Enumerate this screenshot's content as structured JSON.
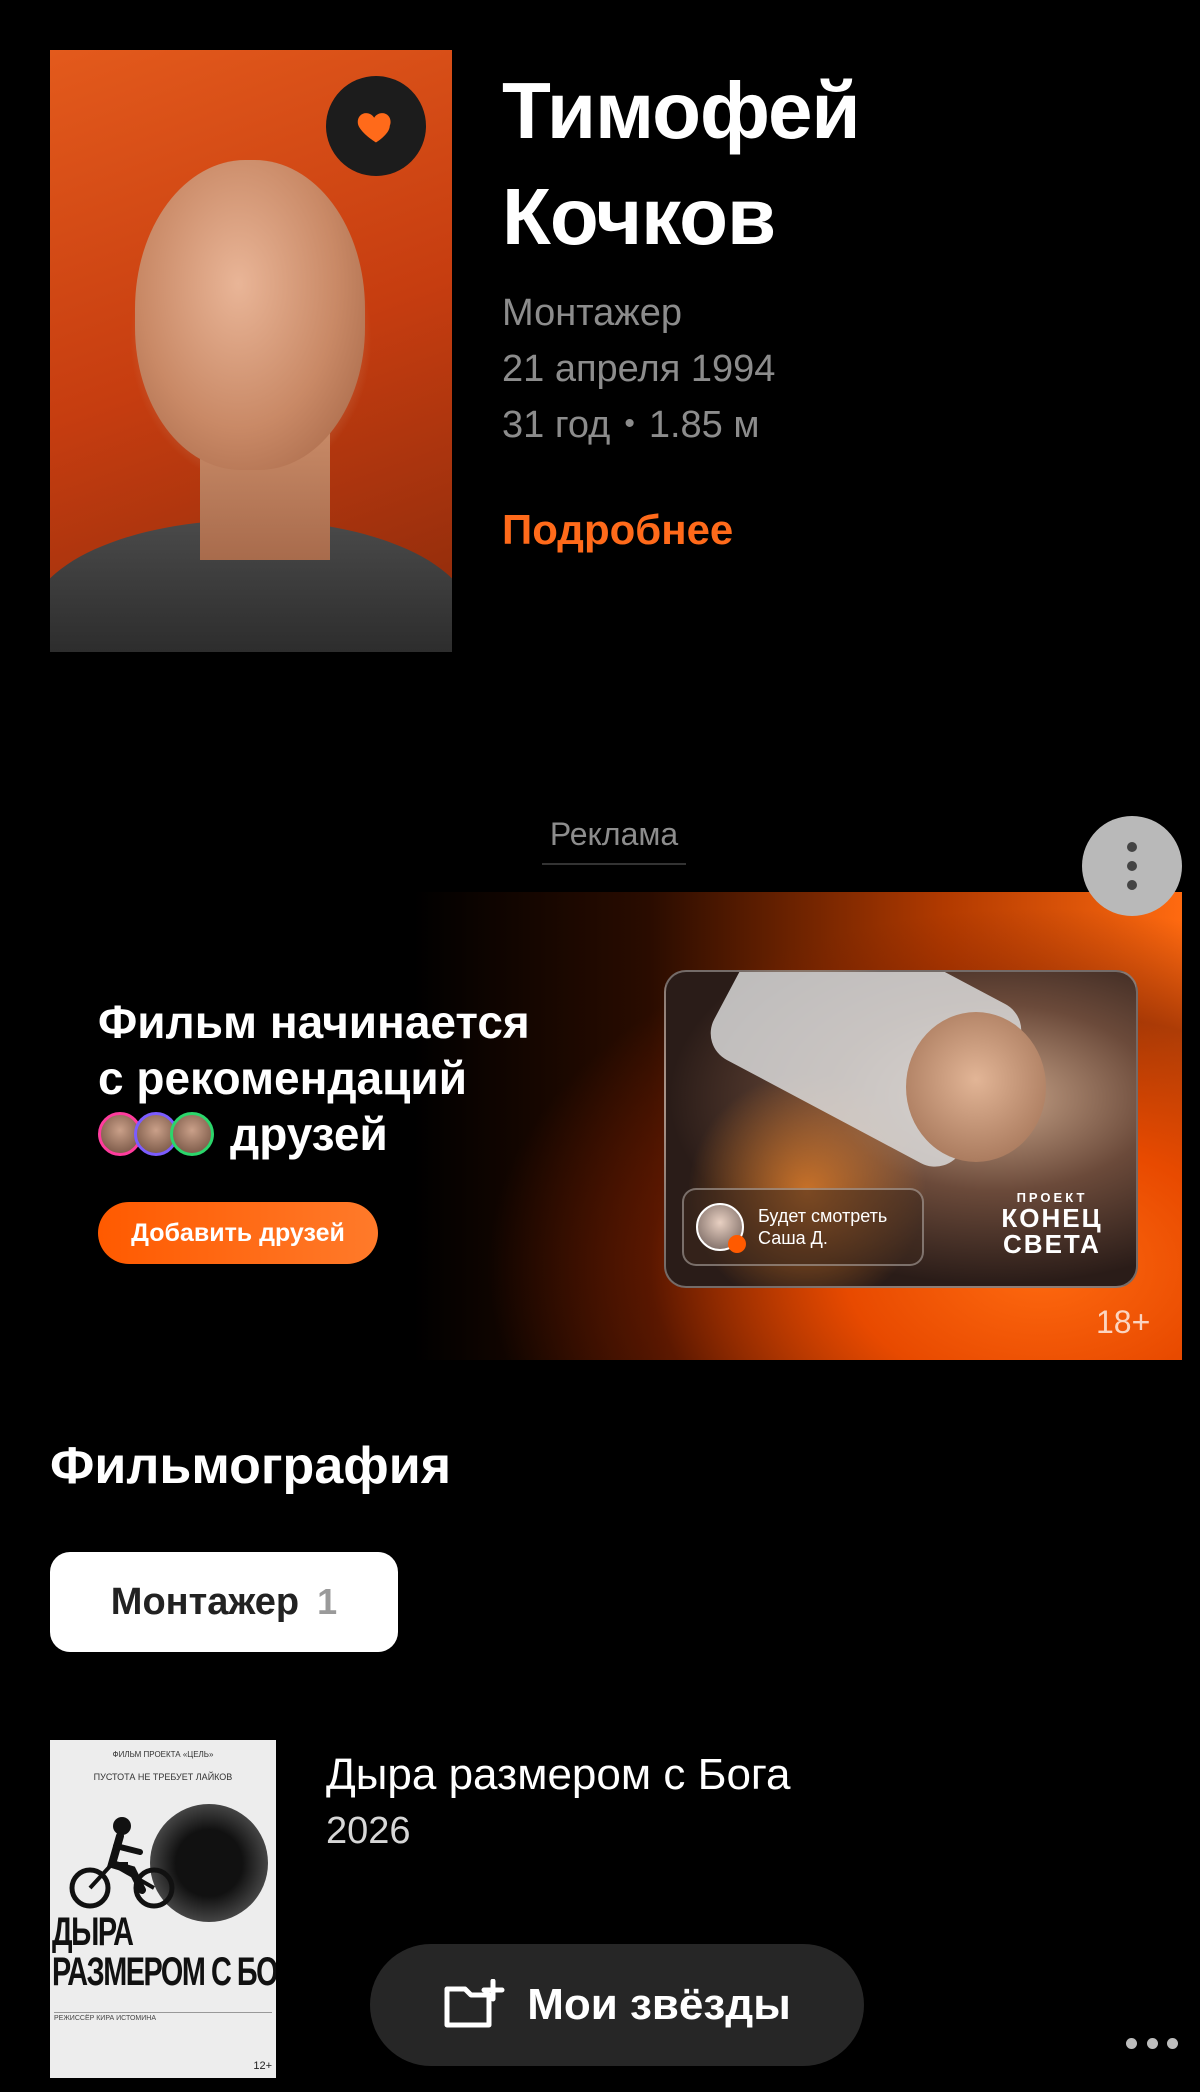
{
  "person": {
    "name_line1": "Тимофей",
    "name_line2": "Кочков",
    "role": "Монтажер",
    "birth_date": "21 апреля 1994",
    "age": "31 год",
    "height": "1.85 м",
    "more_link": "Подробнее",
    "favorite_icon": "heart-icon"
  },
  "ad": {
    "label": "Реклама",
    "menu_icon": "more-vertical-icon",
    "headline_line1": "Фильм начинается",
    "headline_line2": "с рекомендаций",
    "headline_line3": "друзей",
    "cta": "Добавить друзей",
    "watch_line1": "Будет смотреть",
    "watch_line2": "Саша Д.",
    "movie_logo_small": "ПРОЕКТ",
    "movie_logo_line1": "КОНЕЦ",
    "movie_logo_line2": "СВЕТА",
    "age_rating": "18+"
  },
  "filmography": {
    "title": "Фильмография",
    "filter_label": "Монтажер",
    "filter_count": "1",
    "items": [
      {
        "title": "Дыра размером с Бога",
        "year": "2026",
        "poster_top": "ФИЛЬМ ПРОЕКТА «ЦЕЛЬ»",
        "poster_tagline": "ПУСТОТА НЕ ТРЕБУЕТ ЛАЙКОВ",
        "poster_title_line1": "ДЫРА",
        "poster_title_line2": "РАЗМЕРОМ С БОГА.",
        "poster_director": "РЕЖИССЁР КИРА ИСТОМИНА",
        "poster_rating": "12+"
      }
    ]
  },
  "bottom": {
    "my_stars_label": "Мои звёзды",
    "my_stars_icon": "add-folder-icon",
    "overflow_icon": "more-horizontal-icon"
  },
  "colors": {
    "accent": "#ff6a1a",
    "background": "#000000"
  }
}
